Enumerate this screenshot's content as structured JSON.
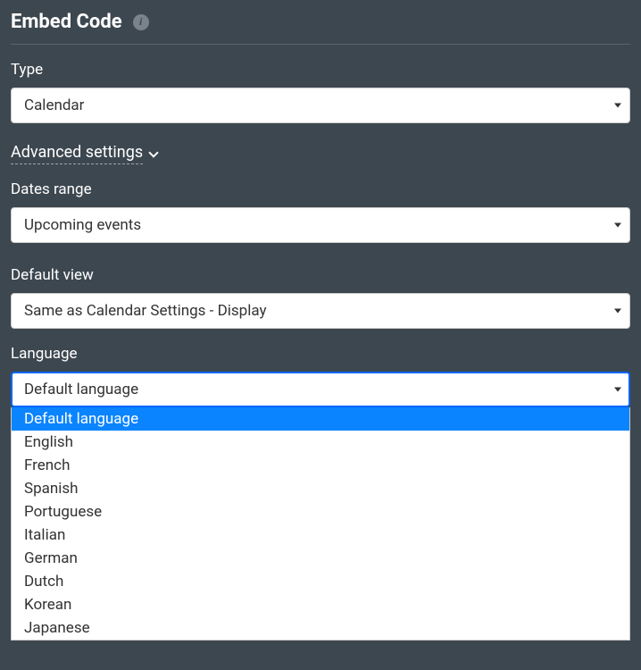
{
  "header": {
    "title": "Embed Code"
  },
  "type_field": {
    "label": "Type",
    "value": "Calendar"
  },
  "advanced": {
    "label": "Advanced settings"
  },
  "dates_range": {
    "label": "Dates range",
    "value": "Upcoming events"
  },
  "default_view": {
    "label": "Default view",
    "value": "Same as Calendar Settings - Display"
  },
  "language": {
    "label": "Language",
    "value": "Default language",
    "options": [
      "Default language",
      "English",
      "French",
      "Spanish",
      "Portuguese",
      "Italian",
      "German",
      "Dutch",
      "Korean",
      "Japanese"
    ]
  }
}
